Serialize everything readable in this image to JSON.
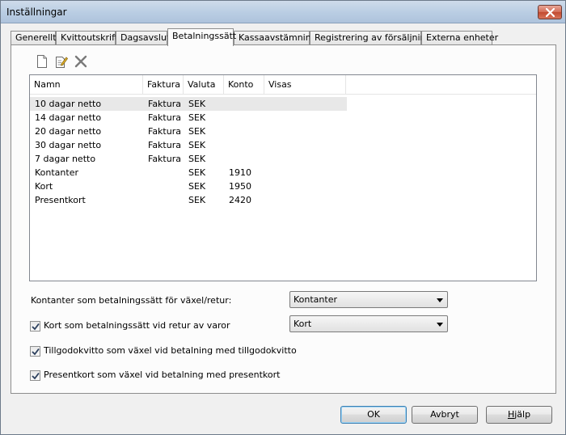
{
  "window": {
    "title": "Inställningar"
  },
  "tabs": [
    {
      "label": "Generellt"
    },
    {
      "label": "Kvittoutskrift"
    },
    {
      "label": "Dagsavslut"
    },
    {
      "label": "Betalningssätt"
    },
    {
      "label": "Kassaavstämning"
    },
    {
      "label": "Registrering av försäljning"
    },
    {
      "label": "Externa enheter"
    }
  ],
  "active_tab": "Betalningssätt",
  "toolbar": {
    "icons": [
      "new-icon",
      "edit-icon",
      "delete-icon"
    ]
  },
  "grid": {
    "columns": [
      "Namn",
      "Faktura",
      "Valuta",
      "Konto",
      "Visas"
    ],
    "rows": [
      {
        "namn": "10 dagar netto",
        "faktura": "Faktura",
        "valuta": "SEK",
        "konto": "",
        "visas": ""
      },
      {
        "namn": "14 dagar netto",
        "faktura": "Faktura",
        "valuta": "SEK",
        "konto": "",
        "visas": ""
      },
      {
        "namn": "20 dagar netto",
        "faktura": "Faktura",
        "valuta": "SEK",
        "konto": "",
        "visas": ""
      },
      {
        "namn": "30 dagar netto",
        "faktura": "Faktura",
        "valuta": "SEK",
        "konto": "",
        "visas": ""
      },
      {
        "namn": "7 dagar netto",
        "faktura": "Faktura",
        "valuta": "SEK",
        "konto": "",
        "visas": ""
      },
      {
        "namn": "Kontanter",
        "faktura": "",
        "valuta": "SEK",
        "konto": "1910",
        "visas": ""
      },
      {
        "namn": "Kort",
        "faktura": "",
        "valuta": "SEK",
        "konto": "1950",
        "visas": ""
      },
      {
        "namn": "Presentkort",
        "faktura": "",
        "valuta": "SEK",
        "konto": "2420",
        "visas": ""
      }
    ]
  },
  "options": {
    "cash_label": "Kontanter som betalningssätt för växel/retur:",
    "cash_value": "Kontanter",
    "card_label": "Kort som betalningssätt vid retur av varor",
    "card_checked": true,
    "card_value": "Kort",
    "credit_label": "Tillgodokvitto som växel vid betalning med tillgodokvitto",
    "credit_checked": true,
    "gift_label": "Presentkort som växel vid betalning med presentkort",
    "gift_checked": true
  },
  "buttons": {
    "ok": "OK",
    "cancel": "Avbryt",
    "help_underlined": "H",
    "help_rest": "jälp"
  },
  "colors": {
    "titlebar": "#b9cde3",
    "close": "#c24a30",
    "selected_row": "#e8e8e8"
  }
}
